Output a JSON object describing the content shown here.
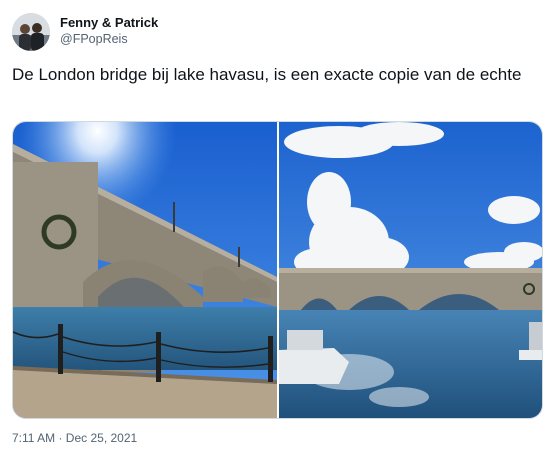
{
  "author": {
    "display_name": "Fenny & Patrick",
    "handle": "@FPopReis"
  },
  "tweet": {
    "text": "De London bridge bij lake havasu, is een exacte copie van de echte",
    "timestamp": "7:11 AM · Dec 25, 2021"
  },
  "colors": {
    "text_primary": "#0f1419",
    "text_secondary": "#536471",
    "border": "#cfd9de",
    "sky": "#1f6fd6",
    "water": "#2f6fa0",
    "stone": "#a09a8c"
  },
  "media": {
    "count": 2,
    "photos": [
      {
        "subject": "bridge-arches-with-sun"
      },
      {
        "subject": "bridge-with-cloud-and-boats"
      }
    ]
  }
}
